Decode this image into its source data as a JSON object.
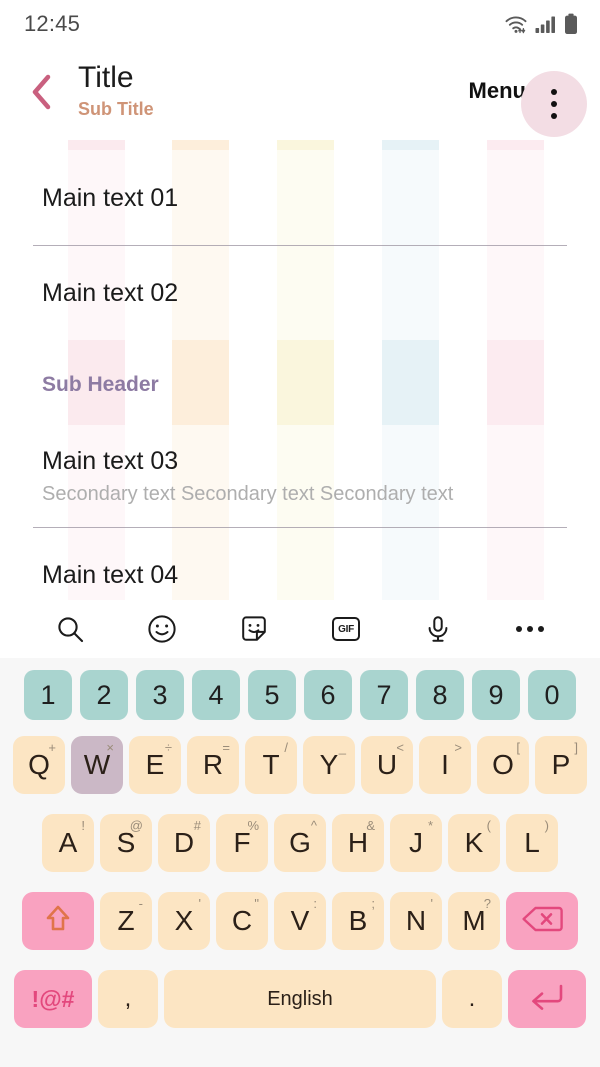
{
  "status_bar": {
    "time": "12:45",
    "icons": [
      "wifi-icon",
      "signal-icon",
      "battery-icon"
    ]
  },
  "app_bar": {
    "back_icon": "chevron-left-icon",
    "title": "Title",
    "subtitle": "Sub Title",
    "menu_label": "Menu",
    "more_icon": "more-vertical-icon"
  },
  "content": {
    "sub_header": "Sub Header",
    "card_one": {
      "items": [
        {
          "main": "Main text 01"
        },
        {
          "main": "Main text 02"
        }
      ]
    },
    "card_two": {
      "items": [
        {
          "main": "Main text 03",
          "secondary": "Secondary text Secondary text Secondary text"
        },
        {
          "main": "Main text 04"
        }
      ]
    }
  },
  "keyboard": {
    "toolbar": [
      {
        "name": "search-icon"
      },
      {
        "name": "emoji-icon"
      },
      {
        "name": "sticker-icon"
      },
      {
        "name": "gif-icon",
        "label": "GIF"
      },
      {
        "name": "microphone-icon"
      },
      {
        "name": "more-horizontal-icon"
      }
    ],
    "number_row": [
      "1",
      "2",
      "3",
      "4",
      "5",
      "6",
      "7",
      "8",
      "9",
      "0"
    ],
    "row_one": [
      {
        "label": "Q",
        "alt": "+",
        "pressed": false
      },
      {
        "label": "W",
        "alt": "×",
        "pressed": true
      },
      {
        "label": "E",
        "alt": "÷",
        "pressed": false
      },
      {
        "label": "R",
        "alt": "=",
        "pressed": false
      },
      {
        "label": "T",
        "alt": "/",
        "pressed": false
      },
      {
        "label": "Y",
        "alt": "_",
        "pressed": false
      },
      {
        "label": "U",
        "alt": "<",
        "pressed": false
      },
      {
        "label": "I",
        "alt": ">",
        "pressed": false
      },
      {
        "label": "O",
        "alt": "[",
        "pressed": false
      },
      {
        "label": "P",
        "alt": "]",
        "pressed": false
      }
    ],
    "row_two": [
      {
        "label": "A",
        "alt": "!"
      },
      {
        "label": "S",
        "alt": "@"
      },
      {
        "label": "D",
        "alt": "#"
      },
      {
        "label": "F",
        "alt": "%"
      },
      {
        "label": "G",
        "alt": "^"
      },
      {
        "label": "H",
        "alt": "&"
      },
      {
        "label": "J",
        "alt": "*"
      },
      {
        "label": "K",
        "alt": "("
      },
      {
        "label": "L",
        "alt": ")"
      }
    ],
    "row_three": [
      {
        "label": "Z",
        "alt": "-"
      },
      {
        "label": "X",
        "alt": "'"
      },
      {
        "label": "C",
        "alt": "\""
      },
      {
        "label": "V",
        "alt": ":"
      },
      {
        "label": "B",
        "alt": ";"
      },
      {
        "label": "N",
        "alt": "'"
      },
      {
        "label": "M",
        "alt": "?"
      }
    ],
    "shift_icon": "shift-arrow-icon",
    "backspace_icon": "backspace-icon",
    "symbols_label": "!@#",
    "comma_label": ",",
    "space_label": "English",
    "period_label": ".",
    "enter_icon": "enter-arrow-icon"
  },
  "colors": {
    "accent_pink": "#c9607f",
    "subtitle_tan": "#cf9477",
    "sub_header_purple": "#8d7ba3",
    "menu_circle": "#f3dde4",
    "number_key": "#a9d4cf",
    "letter_key": "#fce5c3",
    "pressed_key": "#cbb8c6",
    "action_key": "#f9a2c0",
    "action_glyph": "#e3487d",
    "shift_glyph": "#e0744a",
    "keyboard_bg": "#f7f7f7",
    "stripe_pink": "#fbeaee",
    "stripe_peach": "#fdeedb",
    "stripe_yellow": "#faf6dd",
    "stripe_blue": "#e6f2f6",
    "stripe_rose": "#fcebf0"
  }
}
